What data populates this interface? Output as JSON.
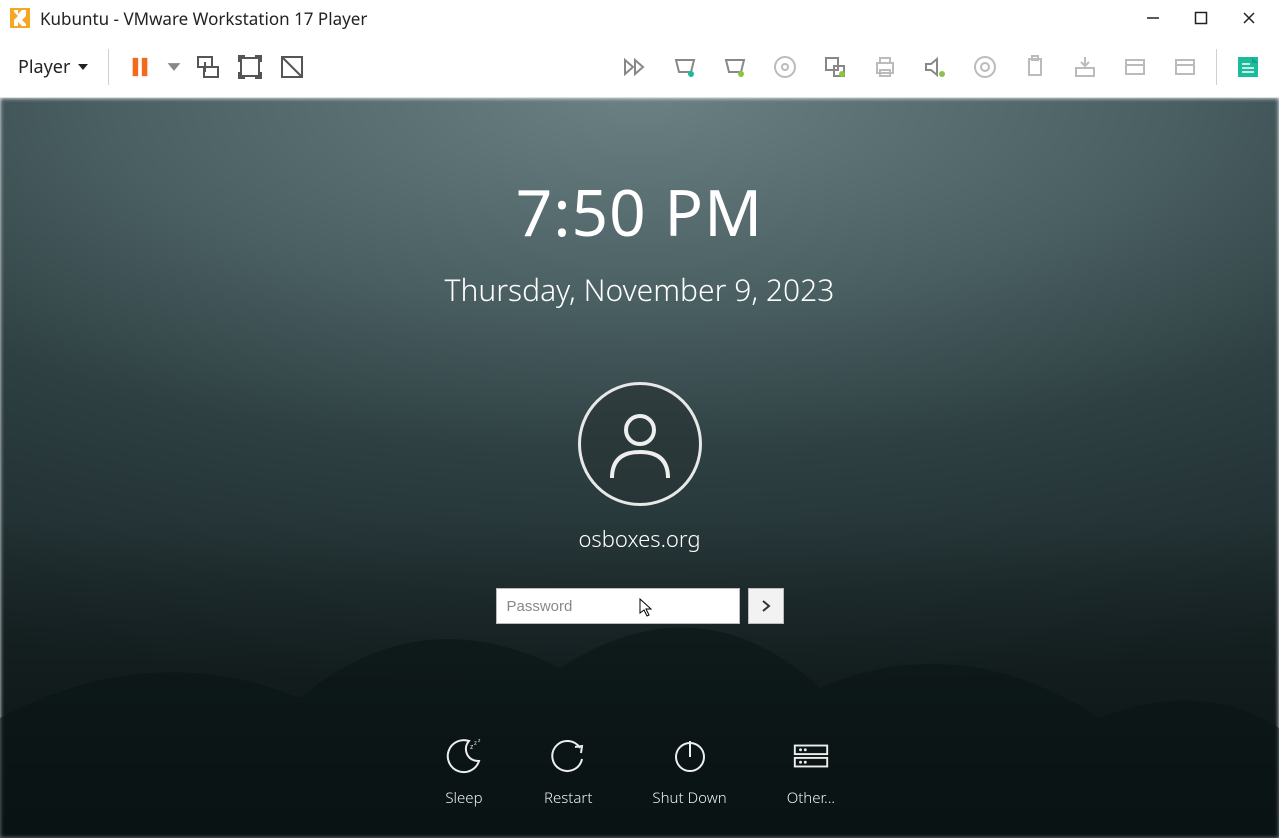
{
  "window": {
    "title": "Kubuntu - VMware Workstation 17 Player"
  },
  "toolbar": {
    "player_label": "Player"
  },
  "lockscreen": {
    "time": "7:50 PM",
    "date": "Thursday, November 9, 2023",
    "username": "osboxes.org",
    "password_placeholder": "Password",
    "actions": {
      "sleep": "Sleep",
      "restart": "Restart",
      "shutdown": "Shut Down",
      "other": "Other..."
    }
  }
}
